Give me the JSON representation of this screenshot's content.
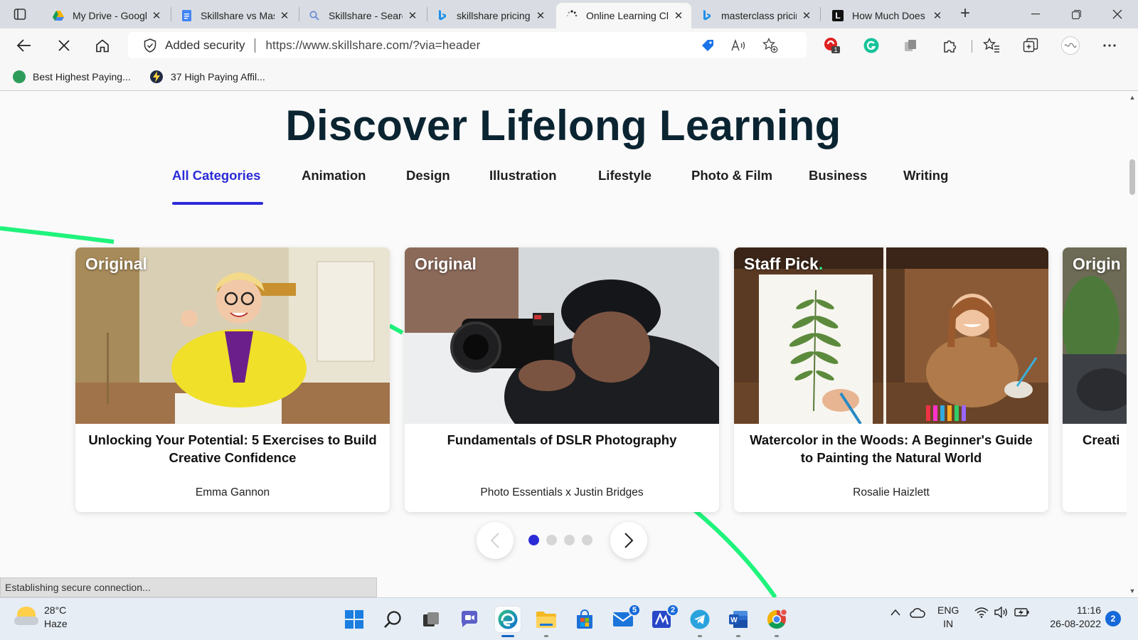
{
  "browser": {
    "tabs": [
      {
        "title": "My Drive - Google Drive",
        "favicon": "google-drive-icon"
      },
      {
        "title": "Skillshare vs MasterClass",
        "favicon": "google-docs-icon"
      },
      {
        "title": "Skillshare - Search",
        "favicon": "search-icon"
      },
      {
        "title": "skillshare pricing",
        "favicon": "bing-icon"
      },
      {
        "title": "Online Learning Classes",
        "favicon": "skillshare-loading-icon",
        "active": true
      },
      {
        "title": "masterclass pricing",
        "favicon": "bing-icon"
      },
      {
        "title": "How Much Does",
        "favicon": "l-letter-icon"
      }
    ],
    "address": {
      "security_label": "Added security",
      "url": "https://www.skillshare.com/?via=header"
    },
    "extension_badge": "1",
    "favorites": [
      {
        "label": "Best Highest Paying...",
        "color": "#2e9b5b"
      },
      {
        "label": "37 High Paying Affil...",
        "color": "#222222"
      }
    ]
  },
  "page": {
    "headline": "Discover Lifelong Learning",
    "categories": [
      {
        "label": "All Categories",
        "active": true
      },
      {
        "label": "Animation"
      },
      {
        "label": "Design"
      },
      {
        "label": "Illustration"
      },
      {
        "label": "Lifestyle"
      },
      {
        "label": "Photo & Film"
      },
      {
        "label": "Business"
      },
      {
        "label": "Writing"
      }
    ],
    "cards": [
      {
        "badge": "Original",
        "title": "Unlocking Your Potential: 5 Exercises to Build Creative Confidence",
        "author": "Emma Gannon"
      },
      {
        "badge": "Original",
        "title": "Fundamentals of DSLR Photography",
        "author": "Photo Essentials x Justin Bridges"
      },
      {
        "badge": "Staff Pick",
        "title": "Watercolor in the Woods: A Beginner's Guide to Painting the Natural World",
        "author": "Rosalie Haizlett"
      },
      {
        "badge": "Origin",
        "title": "Creati",
        "author": ""
      }
    ],
    "carousel": {
      "pages": 4,
      "current": 1
    },
    "status_text": "Establishing secure connection...",
    "accent_color": "#2b2bd8",
    "decor_color": "#1ff37c"
  },
  "taskbar": {
    "weather": {
      "temp": "28°C",
      "condition": "Haze"
    },
    "mail_badge": "5",
    "app_badge": "2",
    "language": {
      "line1": "ENG",
      "line2": "IN"
    },
    "clock": {
      "time": "11:16",
      "date": "26-08-2022"
    },
    "notifications": "2"
  }
}
